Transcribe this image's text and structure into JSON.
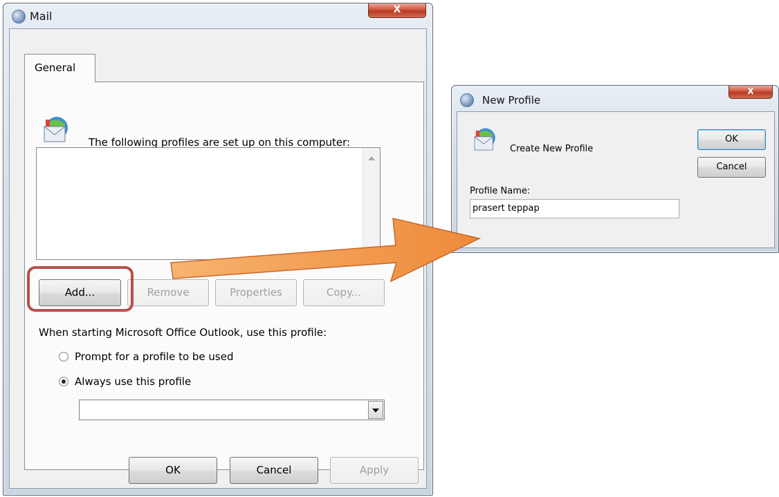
{
  "mail_dialog": {
    "title": "Mail",
    "close_glyph": "X",
    "tab_general": "General",
    "profiles_intro": "The following profiles are set up on this computer:",
    "buttons": {
      "add": "Add...",
      "remove": "Remove",
      "properties": "Properties",
      "copy": "Copy..."
    },
    "startup_label": "When starting Microsoft Office Outlook, use this profile:",
    "radio_prompt": "Prompt for a profile to be used",
    "radio_always": "Always use this profile",
    "selected_radio": "always",
    "profile_select_value": "",
    "footer": {
      "ok": "OK",
      "cancel": "Cancel",
      "apply": "Apply"
    }
  },
  "new_profile_dialog": {
    "title": "New Profile",
    "close_glyph": "X",
    "heading": "Create New Profile",
    "profile_name_label": "Profile Name:",
    "profile_name_value": "prasert  teppap",
    "ok": "OK",
    "cancel": "Cancel"
  },
  "annotation": {
    "highlight_color": "#b8504a",
    "arrow_color": "#f2913f",
    "arrow_outline": "#c9662a"
  }
}
